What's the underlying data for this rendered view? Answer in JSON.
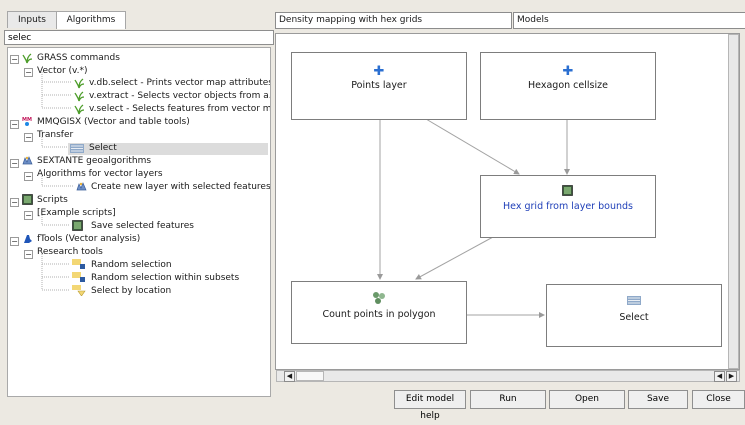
{
  "tabs": [
    "Inputs",
    "Algorithms"
  ],
  "search": {
    "value": "selec"
  },
  "tree": {
    "grass": "GRASS commands",
    "vector": "Vector (v.*)",
    "vdbselect": "v.db.select - Prints vector map attributes",
    "vextract": "v.extract - Selects vector objects from a...",
    "vselect": "v.select - Selects features from vector m...",
    "mmqgis": "MMQGISX (Vector and table tools)",
    "transfer": "Transfer",
    "select": "Select",
    "sextante": "SEXTANTE geoalgorithms",
    "algvector": "Algorithms for vector layers",
    "createlayer": "Create new layer with selected features",
    "scripts": "Scripts",
    "examplescripts": "[Example scripts]",
    "savesel": "Save selected features",
    "ftools": "fTools (Vector analysis)",
    "research": "Research tools",
    "randsel": "Random selection",
    "randsub": "Random selection within subsets",
    "selloc": "Select by location"
  },
  "model": {
    "name": "Density mapping with hex grids",
    "group": "Models"
  },
  "nodes": {
    "points": "Points layer",
    "hexsize": "Hexagon cellsize",
    "hexgrid": "Hex grid from layer bounds",
    "count": "Count points in polygon",
    "select": "Select"
  },
  "buttons": {
    "help": "Edit model help",
    "run": "Run",
    "open": "Open",
    "save": "Save",
    "close": "Close"
  },
  "colors": {
    "accent_blue": "#1f3fb8"
  }
}
